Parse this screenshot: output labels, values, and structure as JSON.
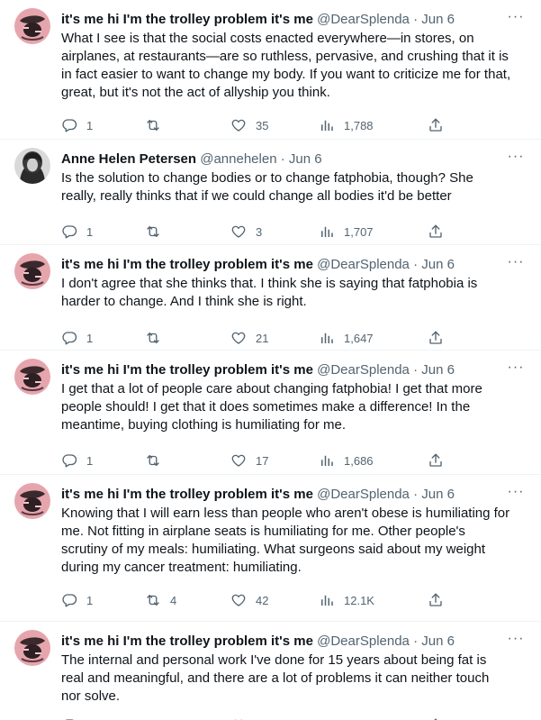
{
  "tweets": [
    {
      "name": "it's me hi I'm the trolley problem it's me",
      "handle": "@DearSplenda",
      "sep": "·",
      "date": "Jun 6",
      "text": "What I see is that the social costs enacted everywhere—in stores, on airplanes, at restaurants—are so ruthless, pervasive, and crushing that it is in fact easier to want to change my body. If you want to criticize me for that, great, but it's not the act of allyship you think.",
      "replies": "1",
      "retweets": "",
      "likes": "35",
      "views": "1,788",
      "avatar": "splenda"
    },
    {
      "name": "Anne Helen Petersen",
      "handle": "@annehelen",
      "sep": "·",
      "date": "Jun 6",
      "text": "Is the solution to change bodies or to change fatphobia, though? She really, really thinks that if we could change all bodies it'd be better",
      "replies": "1",
      "retweets": "",
      "likes": "3",
      "views": "1,707",
      "avatar": "anne"
    },
    {
      "name": "it's me hi I'm the trolley problem it's me",
      "handle": "@DearSplenda",
      "sep": "·",
      "date": "Jun 6",
      "text": "I don't agree that she thinks that. I think she is saying that fatphobia is harder to change. And I think she is right.",
      "replies": "1",
      "retweets": "",
      "likes": "21",
      "views": "1,647",
      "avatar": "splenda"
    },
    {
      "name": "it's me hi I'm the trolley problem it's me",
      "handle": "@DearSplenda",
      "sep": "·",
      "date": "Jun 6",
      "text": "I get that a lot of people care about changing fatphobia! I get that more people should! I get that it does sometimes make a difference! In the meantime, buying clothing is humiliating for me.",
      "replies": "1",
      "retweets": "",
      "likes": "17",
      "views": "1,686",
      "avatar": "splenda"
    },
    {
      "name": "it's me hi I'm the trolley problem it's me",
      "handle": "@DearSplenda",
      "sep": "·",
      "date": "Jun 6",
      "text": "Knowing that I will earn less than people who aren't obese is humiliating for me. Not fitting in airplane seats is humiliating for me. Other people's scrutiny of my meals: humiliating. What surgeons said about my weight during my cancer treatment: humiliating.",
      "replies": "1",
      "retweets": "4",
      "likes": "42",
      "views": "12.1K",
      "avatar": "splenda"
    },
    {
      "name": "it's me hi I'm the trolley problem it's me",
      "handle": "@DearSplenda",
      "sep": "·",
      "date": "Jun 6",
      "text": "The internal and personal work I've done for 15 years about being fat is real and meaningful, and there are a lot of problems it can neither touch nor solve.",
      "replies": "",
      "retweets": "",
      "likes": "",
      "views": "",
      "avatar": "splenda"
    }
  ],
  "icons": {
    "reply": "reply-icon",
    "retweet": "retweet-icon",
    "like": "heart-icon",
    "views": "views-icon",
    "share": "share-icon",
    "more": "more-icon"
  },
  "colors": {
    "text": "#0f1419",
    "secondary": "#536471",
    "divider": "#eff3f4",
    "avatar_pink": "#e6a5ad"
  }
}
